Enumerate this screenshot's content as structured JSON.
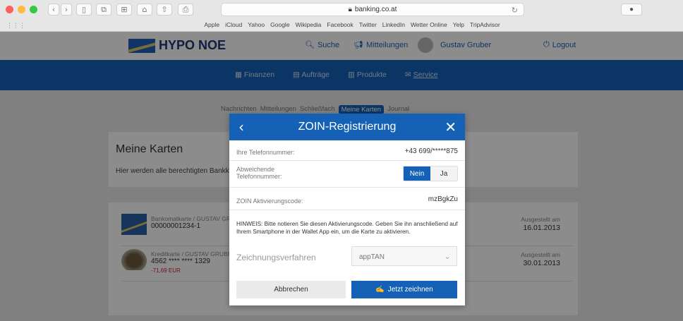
{
  "browser": {
    "url": "banking.co.at",
    "bookmarks": [
      "Apple",
      "iCloud",
      "Yahoo",
      "Google",
      "Wikipedia",
      "Facebook",
      "Twitter",
      "LinkedIn",
      "Wetter Online",
      "Yelp",
      "TripAdvisor"
    ]
  },
  "header": {
    "brand": "HYPO NOE",
    "search": "Suche",
    "messages": "Mitteilungen",
    "user": "Gustav Gruber",
    "logout": "Logout"
  },
  "mainnav": [
    "Finanzen",
    "Aufträge",
    "Produkte",
    "Service"
  ],
  "subnav": [
    "Nachrichten",
    "Mitteilungen",
    "Schließfach",
    "Meine Karten",
    "Journal"
  ],
  "page": {
    "title": "Meine Karten",
    "intro": "Hier werden alle berechtigten Bankkar"
  },
  "cards": [
    {
      "type": "Bankomatkarte / GUSTAV GR",
      "number": "00000001234-1",
      "amount": "",
      "issued_label": "Ausgestellt am",
      "issued": "16.01.2013"
    },
    {
      "type": "Kreditkarte / GUSTAV GRUBE",
      "number": "4562 **** **** 1329",
      "amount": "-71,69 EUR",
      "issued_label": "Ausgestellt am",
      "issued": "30.01.2013"
    }
  ],
  "modal": {
    "title": "ZOIN-Registrierung",
    "phone_label": "Ihre Telefonnummer:",
    "phone_value": "+43 699/*****875",
    "alt_phone_label_1": "Abweichende",
    "alt_phone_label_2": "Telefonnummer:",
    "no": "Nein",
    "yes": "Ja",
    "code_label": "ZOIN Aktivierungscode:",
    "code_value": "mzBgkZu",
    "hint_1": "HINWEIS: Bitte notieren Sie diesen Aktivierungscode. Geben Sie ihn anschließend auf",
    "hint_2": "Ihrem Smartphone in der Wallet App ein, um die Karte zu aktivieren.",
    "procedure_label": "Zeichnungsverfahren",
    "procedure_value": "appTAN",
    "cancel": "Abbrechen",
    "sign": "Jetzt zeichnen"
  },
  "colors": {
    "primary": "#1561b6",
    "amount_negative": "#cc2233"
  }
}
